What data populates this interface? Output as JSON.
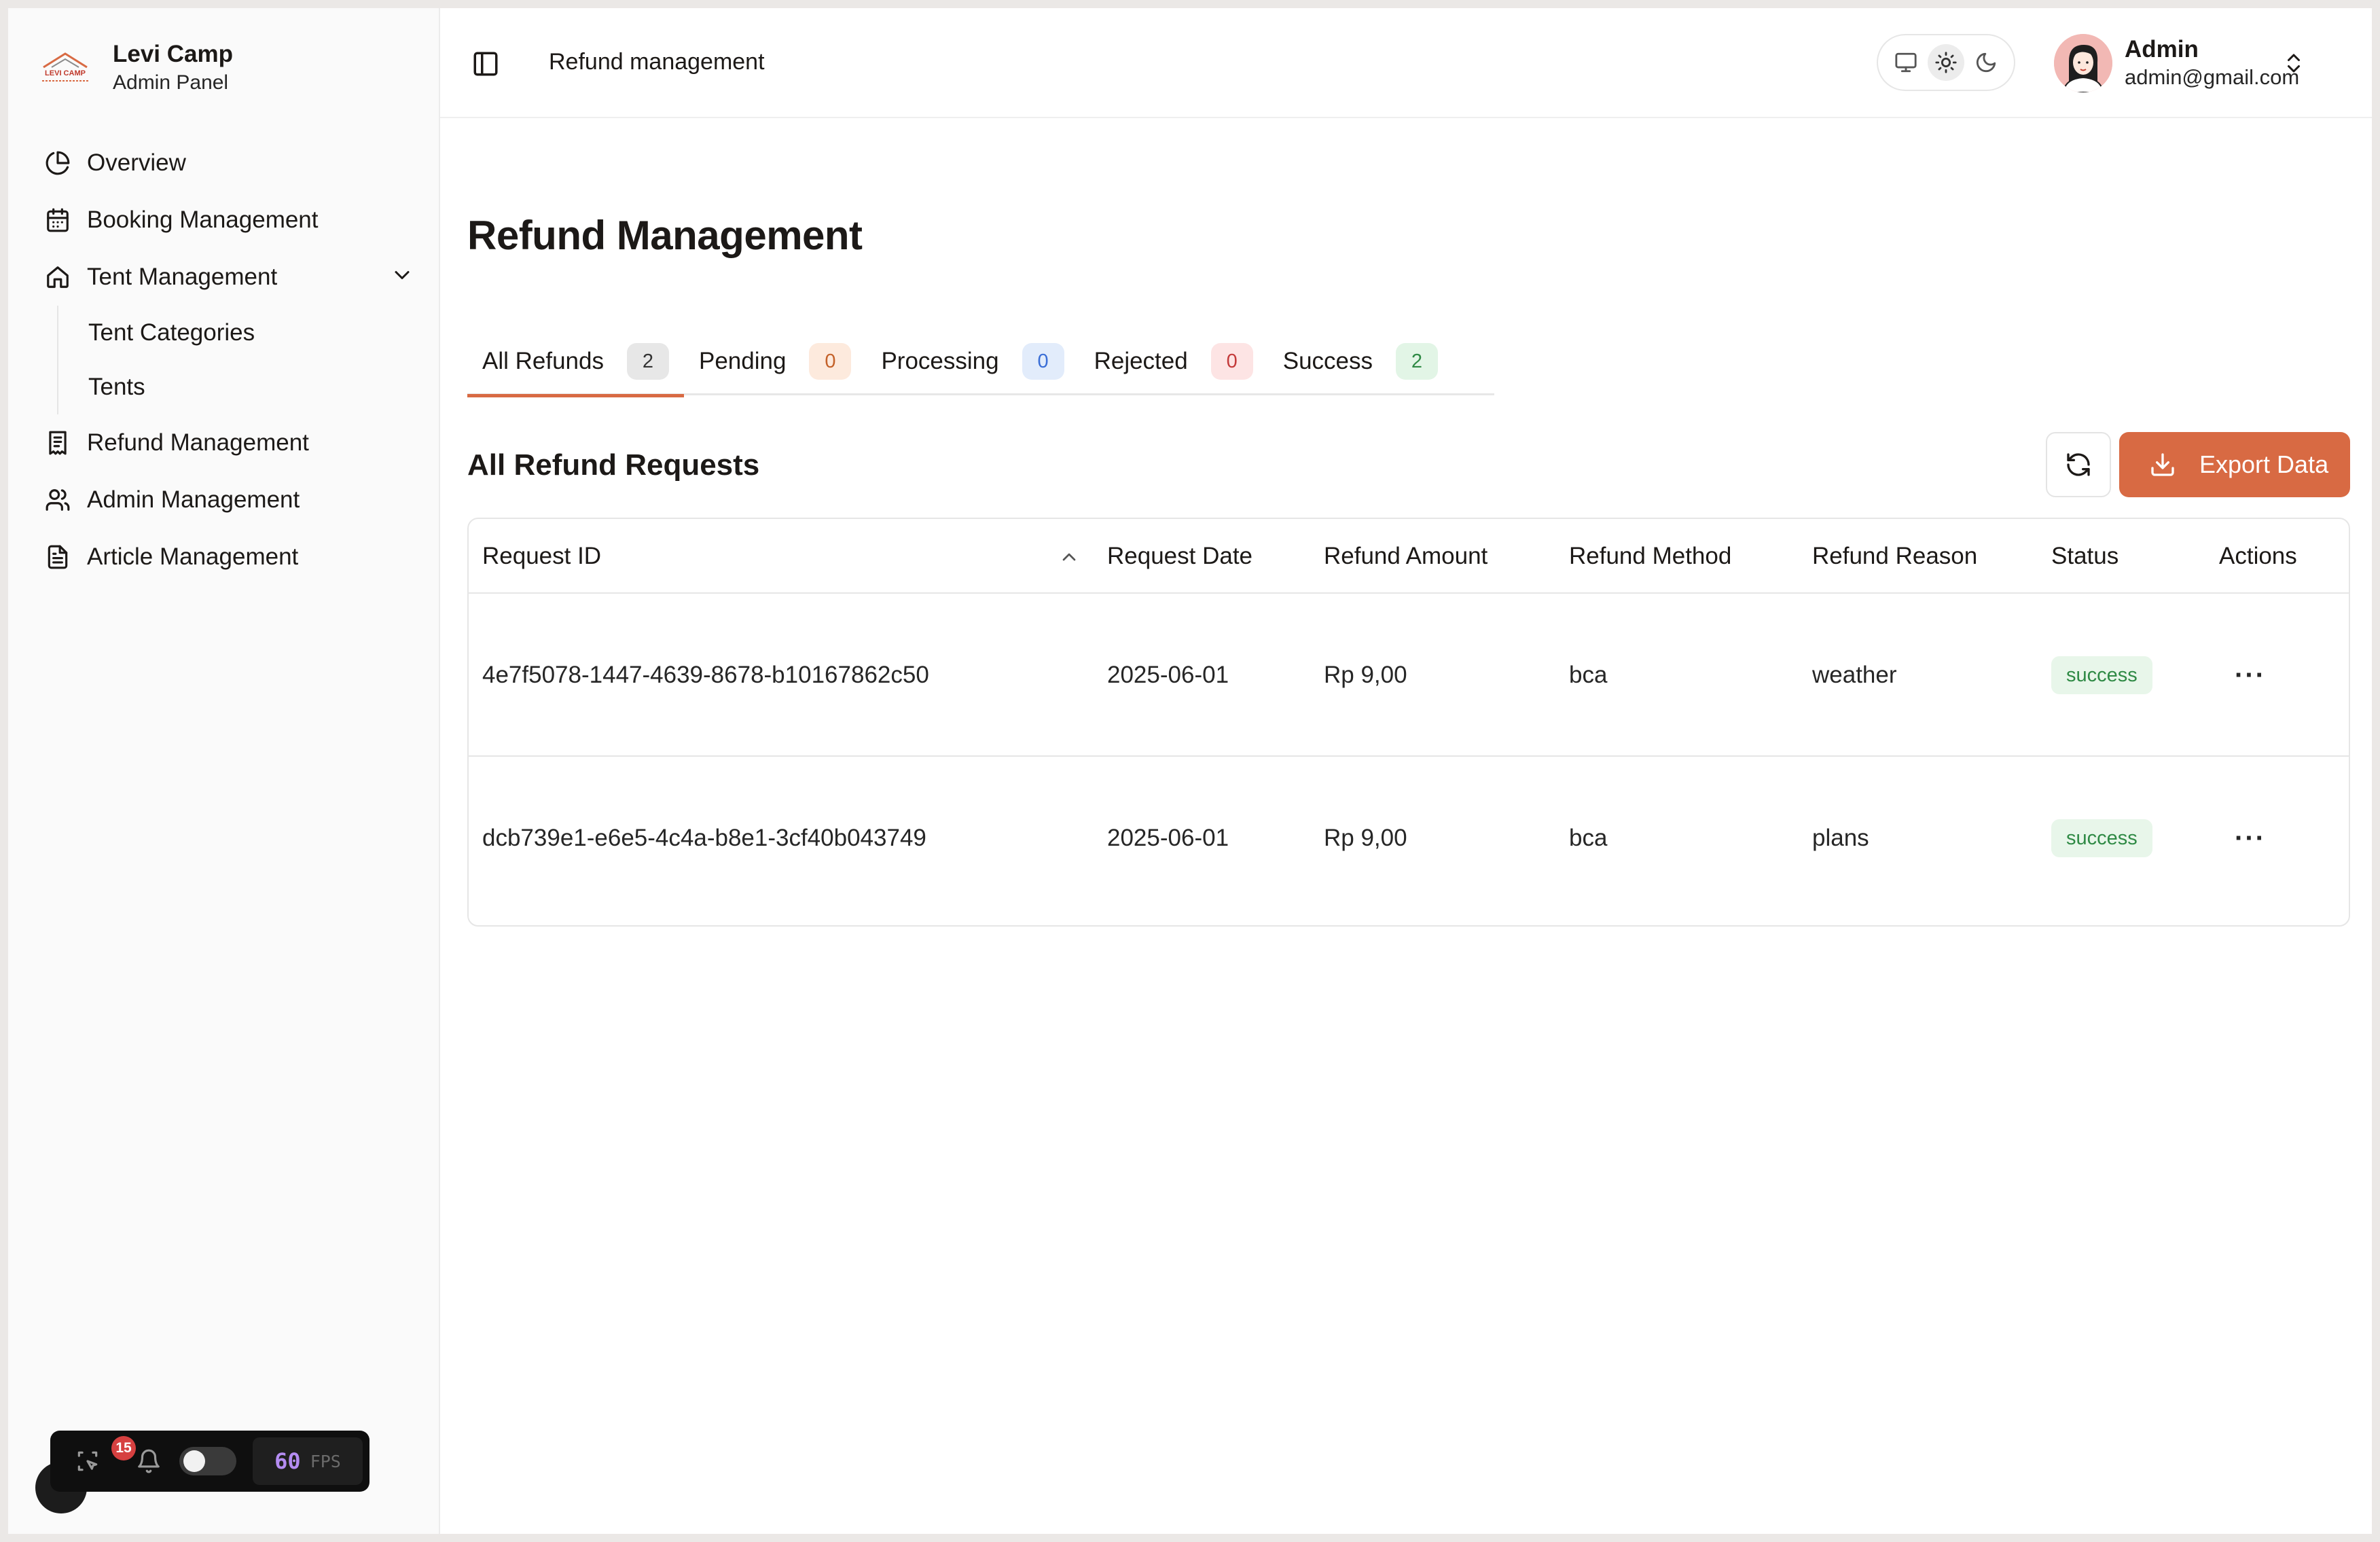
{
  "brand": {
    "name": "Levi Camp",
    "subtitle": "Admin Panel",
    "logo_text": "LEVI CAMP"
  },
  "sidebar": {
    "items": [
      {
        "label": "Overview",
        "icon": "pie-chart-icon"
      },
      {
        "label": "Booking Management",
        "icon": "calendar-icon"
      },
      {
        "label": "Tent Management",
        "icon": "home-icon",
        "expanded": true,
        "children": [
          {
            "label": "Tent Categories"
          },
          {
            "label": "Tents"
          }
        ]
      },
      {
        "label": "Refund Management",
        "icon": "receipt-icon"
      },
      {
        "label": "Admin Management",
        "icon": "users-icon"
      },
      {
        "label": "Article Management",
        "icon": "document-icon"
      }
    ]
  },
  "header": {
    "breadcrumb": "Refund management",
    "theme_options": [
      "system",
      "light",
      "dark"
    ],
    "theme_selected": "light",
    "user": {
      "name": "Admin",
      "email": "admin@gmail.com"
    }
  },
  "main": {
    "title": "Refund Management",
    "tabs": [
      {
        "label": "All Refunds",
        "count": "2",
        "active": true
      },
      {
        "label": "Pending",
        "count": "0"
      },
      {
        "label": "Processing",
        "count": "0"
      },
      {
        "label": "Rejected",
        "count": "0"
      },
      {
        "label": "Success",
        "count": "2"
      }
    ],
    "section_title": "All Refund Requests",
    "export_label": "Export Data",
    "table": {
      "columns": [
        "Request ID",
        "Request Date",
        "Refund Amount",
        "Refund Method",
        "Refund Reason",
        "Status",
        "Actions"
      ],
      "sort_column": "Request ID",
      "sort_direction": "ascending",
      "rows": [
        {
          "id": "4e7f5078-1447-4639-8678-b10167862c50",
          "date": "2025-06-01",
          "amount": "Rp 9,00",
          "method": "bca",
          "reason": "weather",
          "status": "success",
          "actions": "···"
        },
        {
          "id": "dcb739e1-e6e5-4c4a-b8e1-3cf40b043749",
          "date": "2025-06-01",
          "amount": "Rp 9,00",
          "method": "bca",
          "reason": "plans",
          "status": "success",
          "actions": "···"
        }
      ]
    }
  },
  "devtools": {
    "notification_count": "15",
    "fps_value": "60",
    "fps_label": "FPS"
  },
  "colors": {
    "accent": "#d86a43",
    "success_bg": "#e8f6ea",
    "success_text": "#2f8a45"
  }
}
